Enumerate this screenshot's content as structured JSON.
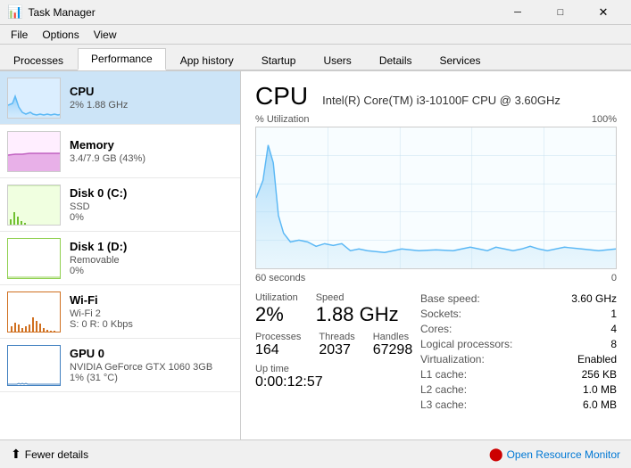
{
  "window": {
    "title": "Task Manager",
    "icon": "⬛"
  },
  "menu": {
    "items": [
      "File",
      "Options",
      "View"
    ]
  },
  "tabs": [
    {
      "id": "processes",
      "label": "Processes",
      "active": false
    },
    {
      "id": "performance",
      "label": "Performance",
      "active": true
    },
    {
      "id": "app-history",
      "label": "App history",
      "active": false
    },
    {
      "id": "startup",
      "label": "Startup",
      "active": false
    },
    {
      "id": "users",
      "label": "Users",
      "active": false
    },
    {
      "id": "details",
      "label": "Details",
      "active": false
    },
    {
      "id": "services",
      "label": "Services",
      "active": false
    }
  ],
  "sidebar": {
    "items": [
      {
        "id": "cpu",
        "name": "CPU",
        "sub1": "2% 1.88 GHz",
        "sub2": "",
        "active": true,
        "graph_type": "cpu"
      },
      {
        "id": "memory",
        "name": "Memory",
        "sub1": "3.4/7.9 GB (43%)",
        "sub2": "",
        "active": false,
        "graph_type": "mem"
      },
      {
        "id": "disk0",
        "name": "Disk 0 (C:)",
        "sub1": "SSD",
        "sub2": "0%",
        "active": false,
        "graph_type": "disk0"
      },
      {
        "id": "disk1",
        "name": "Disk 1 (D:)",
        "sub1": "Removable",
        "sub2": "0%",
        "active": false,
        "graph_type": "disk1"
      },
      {
        "id": "wifi",
        "name": "Wi-Fi",
        "sub1": "Wi-Fi 2",
        "sub2": "S: 0 R: 0 Kbps",
        "active": false,
        "graph_type": "wifi"
      },
      {
        "id": "gpu0",
        "name": "GPU 0",
        "sub1": "NVIDIA GeForce GTX 1060 3GB",
        "sub2": "1% (31 °C)",
        "active": false,
        "graph_type": "gpu"
      }
    ]
  },
  "main": {
    "title": "CPU",
    "subtitle": "Intel(R) Core(TM) i3-10100F CPU @ 3.60GHz",
    "chart": {
      "y_label_top": "% Utilization",
      "y_label_bottom": "100%",
      "x_label_left": "60 seconds",
      "x_label_right": "0"
    },
    "utilization_label": "Utilization",
    "utilization_value": "2%",
    "speed_label": "Speed",
    "speed_value": "1.88 GHz",
    "processes_label": "Processes",
    "processes_value": "164",
    "threads_label": "Threads",
    "threads_value": "2037",
    "handles_label": "Handles",
    "handles_value": "67298",
    "uptime_label": "Up time",
    "uptime_value": "0:00:12:57",
    "info": {
      "base_speed_label": "Base speed:",
      "base_speed_value": "3.60 GHz",
      "sockets_label": "Sockets:",
      "sockets_value": "1",
      "cores_label": "Cores:",
      "cores_value": "4",
      "logical_label": "Logical processors:",
      "logical_value": "8",
      "virt_label": "Virtualization:",
      "virt_value": "Enabled",
      "l1_label": "L1 cache:",
      "l1_value": "256 KB",
      "l2_label": "L2 cache:",
      "l2_value": "1.0 MB",
      "l3_label": "L3 cache:",
      "l3_value": "6.0 MB"
    }
  },
  "bottom": {
    "fewer_details": "Fewer details",
    "open_monitor": "Open Resource Monitor"
  },
  "colors": {
    "cpu_line": "#5bb8f5",
    "cpu_fill": "#bde0f8",
    "accent": "#0078d4"
  }
}
